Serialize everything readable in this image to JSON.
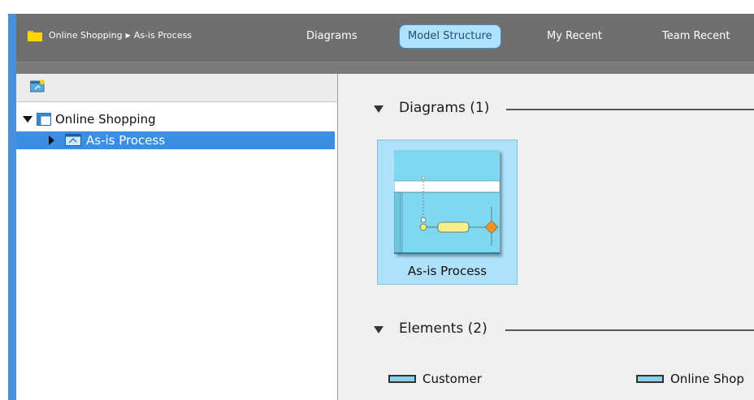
{
  "breadcrumb": {
    "project": "Online Shopping",
    "current": "As-is Process"
  },
  "tabs": [
    {
      "label": "Diagrams",
      "active": false
    },
    {
      "label": "Model Structure",
      "active": true
    },
    {
      "label": "My Recent",
      "active": false
    },
    {
      "label": "Team Recent",
      "active": false
    }
  ],
  "tree": {
    "root": {
      "label": "Online Shopping",
      "expanded": true
    },
    "child": {
      "label": "As-is Process",
      "selected": true
    }
  },
  "diagrams": {
    "heading": "Diagrams (1)",
    "items": [
      {
        "label": "As-is Process"
      }
    ]
  },
  "elements": {
    "heading": "Elements (2)",
    "items": [
      {
        "label": "Customer"
      },
      {
        "label": "Online Shop"
      }
    ]
  },
  "colors": {
    "accent": "#4a90d9",
    "selection": "#3b8ee5",
    "active_tab": "#aee2ff",
    "thumbnail": "#7dd8f0"
  }
}
